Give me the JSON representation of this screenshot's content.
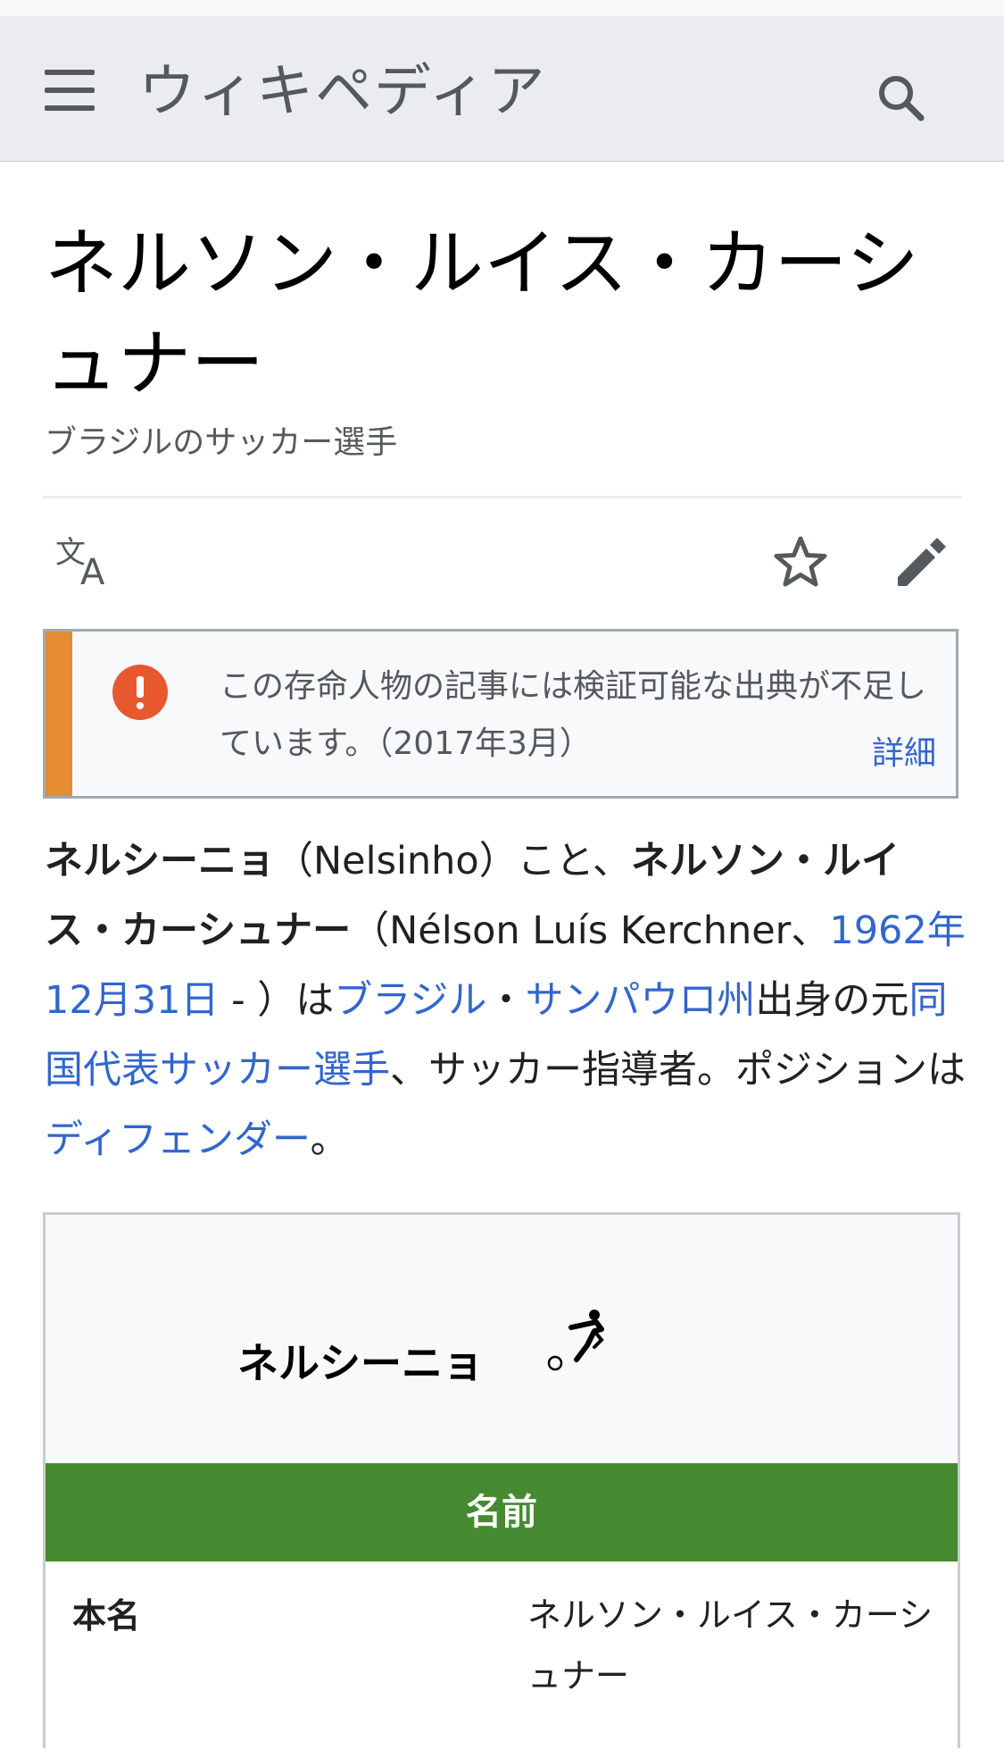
{
  "header": {
    "wordmark": "ウィキペディア"
  },
  "article": {
    "title": "ネルソン・ルイス・カーシュナー",
    "description": "ブラジルのサッカー選手"
  },
  "notice": {
    "text": "この存命人物の記事には検証可能な出典が不足しています。（2017年3月）",
    "more_label": "詳細",
    "accent_color": "#e58c32"
  },
  "lead": {
    "bold1": "ネルシーニョ",
    "t1": "（Nelsinho）こと、",
    "bold2": "ネルソン・ルイス・カーシュナー",
    "t2": "（Nélson Luís Kerchner、",
    "link_birth": "1962年12月31日",
    "t3": " - ）は",
    "link_brazil": "ブラジル",
    "t4": "・",
    "link_sp": "サンパウロ州",
    "t5": "出身の元",
    "link_national": "同国代表",
    "link_soccer": "サッカー選手",
    "t6": "、サッカー指導者。ポジションは",
    "link_df": "ディフェンダー",
    "t7": "。"
  },
  "infobox": {
    "name": "ネルシーニョ",
    "icon": "soccer-player-icon",
    "section_header": "名前",
    "section_color": "#458a30",
    "rows": [
      {
        "label": "本名",
        "value": "ネルソン・ルイス・カーシュナー"
      }
    ]
  },
  "colors": {
    "link": "#3366cc",
    "header_bg": "#eaecf0"
  }
}
